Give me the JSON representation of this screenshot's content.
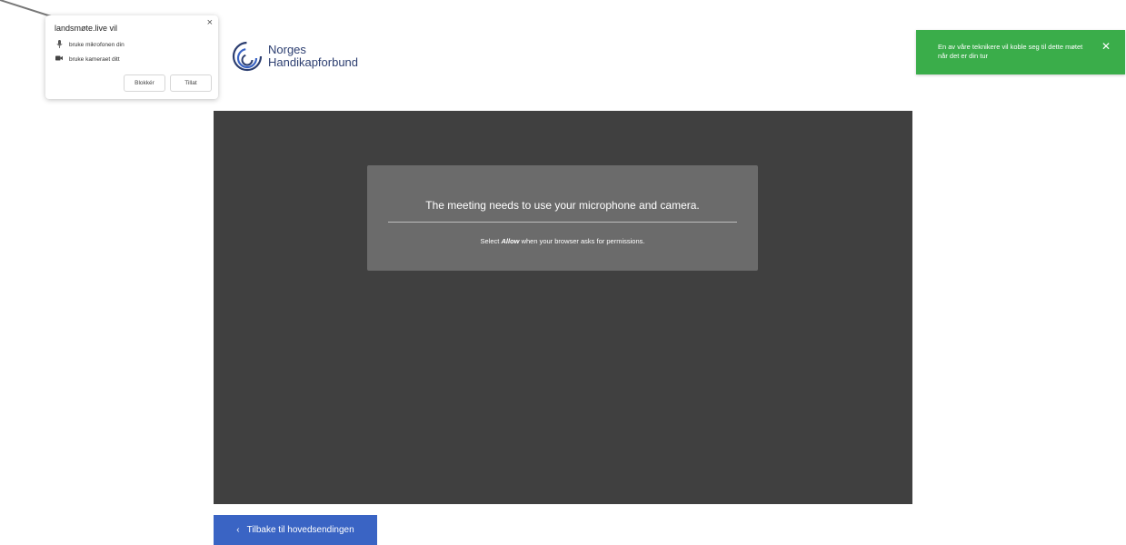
{
  "permission_popup": {
    "title": "landsmøte.live vil",
    "items": [
      {
        "icon": "microphone-icon",
        "label": "bruke mikrofonen din"
      },
      {
        "icon": "camera-icon",
        "label": "bruke kameraet ditt"
      }
    ],
    "block_label": "Blokkér",
    "allow_label": "Tillat",
    "close_glyph": "×"
  },
  "logo": {
    "line1": "Norges",
    "line2": "Handikapforbund",
    "color": "#2c3e70"
  },
  "toast": {
    "message": "En av våre teknikere vil koble seg til dette møtet når det er din tur",
    "close_glyph": "✕",
    "color": "#3aad4a"
  },
  "meeting": {
    "title": "The meeting needs to use your microphone and camera.",
    "sub_prefix": "Select ",
    "sub_bold": "Allow",
    "sub_suffix": " when your browser asks for permissions."
  },
  "back_button": {
    "label": "Tilbake til hovedsendingen",
    "chevron": "‹",
    "color": "#3a64c4"
  }
}
